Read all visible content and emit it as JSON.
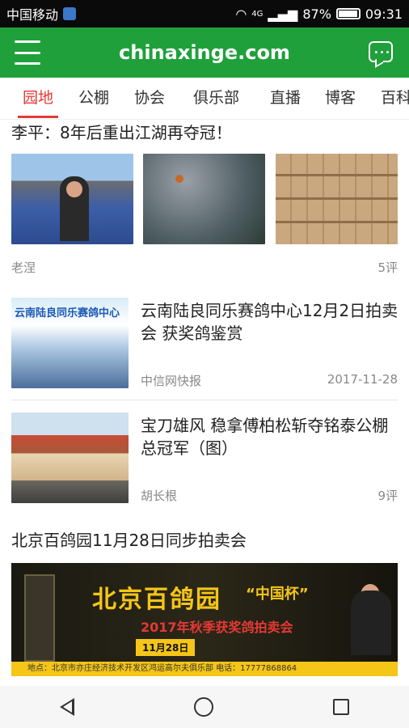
{
  "status_bar": {
    "carrier": "中国移动",
    "network": "4G",
    "battery": "87%",
    "battery_level": 0.87,
    "time": "09:31"
  },
  "header": {
    "title": "chinaxinge.com"
  },
  "tabs": [
    {
      "label": "园地",
      "active": true
    },
    {
      "label": "公棚",
      "active": false
    },
    {
      "label": "协会",
      "active": false
    },
    {
      "label": "俱乐部",
      "active": false
    },
    {
      "label": "直播",
      "active": false
    },
    {
      "label": "博客",
      "active": false
    },
    {
      "label": "百科",
      "active": false
    }
  ],
  "feed": {
    "item1": {
      "title": "李平：8年后重出江湖再夺冠！",
      "author": "老涅",
      "comments": "5评"
    },
    "item2": {
      "title": "云南陆良同乐赛鸽中心12月2日拍卖会 获奖鸽鉴赏",
      "source": "中信网快报",
      "date": "2017-11-28",
      "thumb_text": "云南陆良同乐赛鸽中心"
    },
    "item3": {
      "title": "宝刀雄风 稳拿傅柏松斩夺铭泰公棚总冠军（图）",
      "author": "胡长根",
      "comments": "9评"
    },
    "item4": {
      "title": "北京百鸽园11月28日同步拍卖会",
      "ad": {
        "headline": "北京百鸽园",
        "cup": "“中国杯”",
        "subtitle": "2017年秋季获奖鸽拍卖会",
        "date": "11月28日",
        "bottom": "地点：北京市亦庄经济技术开发区鸿运高尔夫俱乐部    电话：17777868864"
      }
    }
  }
}
